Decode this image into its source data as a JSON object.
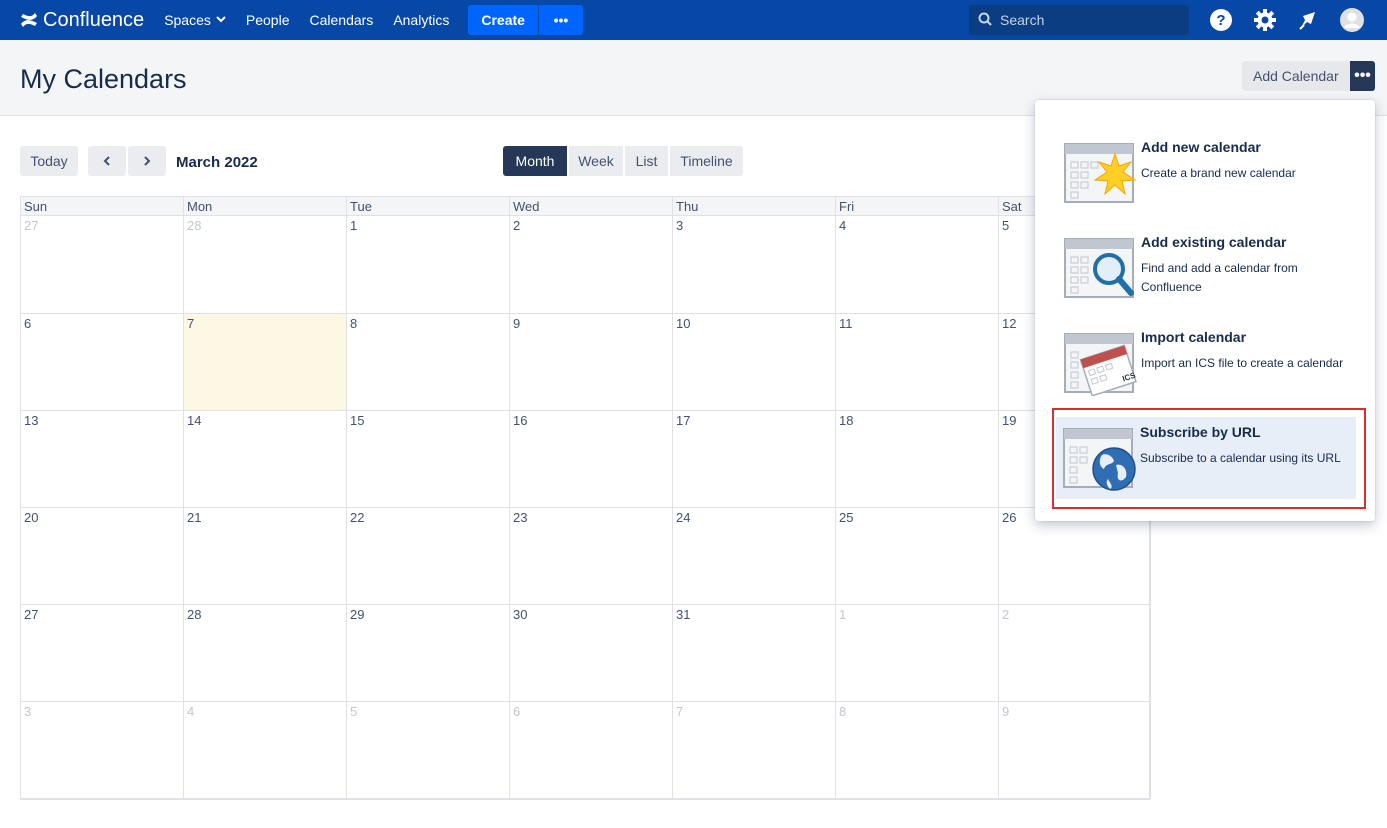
{
  "nav": {
    "logo": "Confluence",
    "spaces": "Spaces",
    "people": "People",
    "calendars": "Calendars",
    "analytics": "Analytics",
    "create": "Create",
    "more": "•••",
    "search_placeholder": "Search",
    "icons": [
      "help-icon",
      "settings-icon",
      "notifications-icon",
      "avatar-icon"
    ]
  },
  "header": {
    "title": "My Calendars",
    "add_calendar": "Add Calendar",
    "more": "•••"
  },
  "toolbar": {
    "today": "Today",
    "prev": "‹",
    "next": "›",
    "month": "March 2022",
    "views": [
      "Month",
      "Week",
      "List",
      "Timeline"
    ],
    "active_view": "Month"
  },
  "calendar": {
    "weekdays": [
      "Sun",
      "Mon",
      "Tue",
      "Wed",
      "Thu",
      "Fri",
      "Sat"
    ],
    "weeks": [
      [
        "27",
        "28",
        "1",
        "2",
        "3",
        "4",
        "5"
      ],
      [
        "6",
        "7",
        "8",
        "9",
        "10",
        "11",
        "12"
      ],
      [
        "13",
        "14",
        "15",
        "16",
        "17",
        "18",
        "19"
      ],
      [
        "20",
        "21",
        "22",
        "23",
        "24",
        "25",
        "26"
      ],
      [
        "27",
        "28",
        "29",
        "30",
        "31",
        "1",
        "2"
      ],
      [
        "3",
        "4",
        "5",
        "6",
        "7",
        "8",
        "9"
      ]
    ],
    "today": "7"
  },
  "dropdown": {
    "items": [
      {
        "title": "Add new calendar",
        "desc": "Create a brand new calendar"
      },
      {
        "title": "Add existing calendar",
        "desc": "Find and add a calendar from Confluence"
      },
      {
        "title": "Import calendar",
        "desc": "Import an ICS file to create a calendar"
      },
      {
        "title": "Subscribe by URL",
        "desc": "Subscribe to a calendar using its URL"
      }
    ],
    "ics_label": "ICS"
  },
  "colors": {
    "nav_bg": "#0747a6",
    "create_bg": "#0065ff",
    "active_view_bg": "#253858",
    "today_bg": "#fdf8e4",
    "highlight": "#d32f2f"
  }
}
